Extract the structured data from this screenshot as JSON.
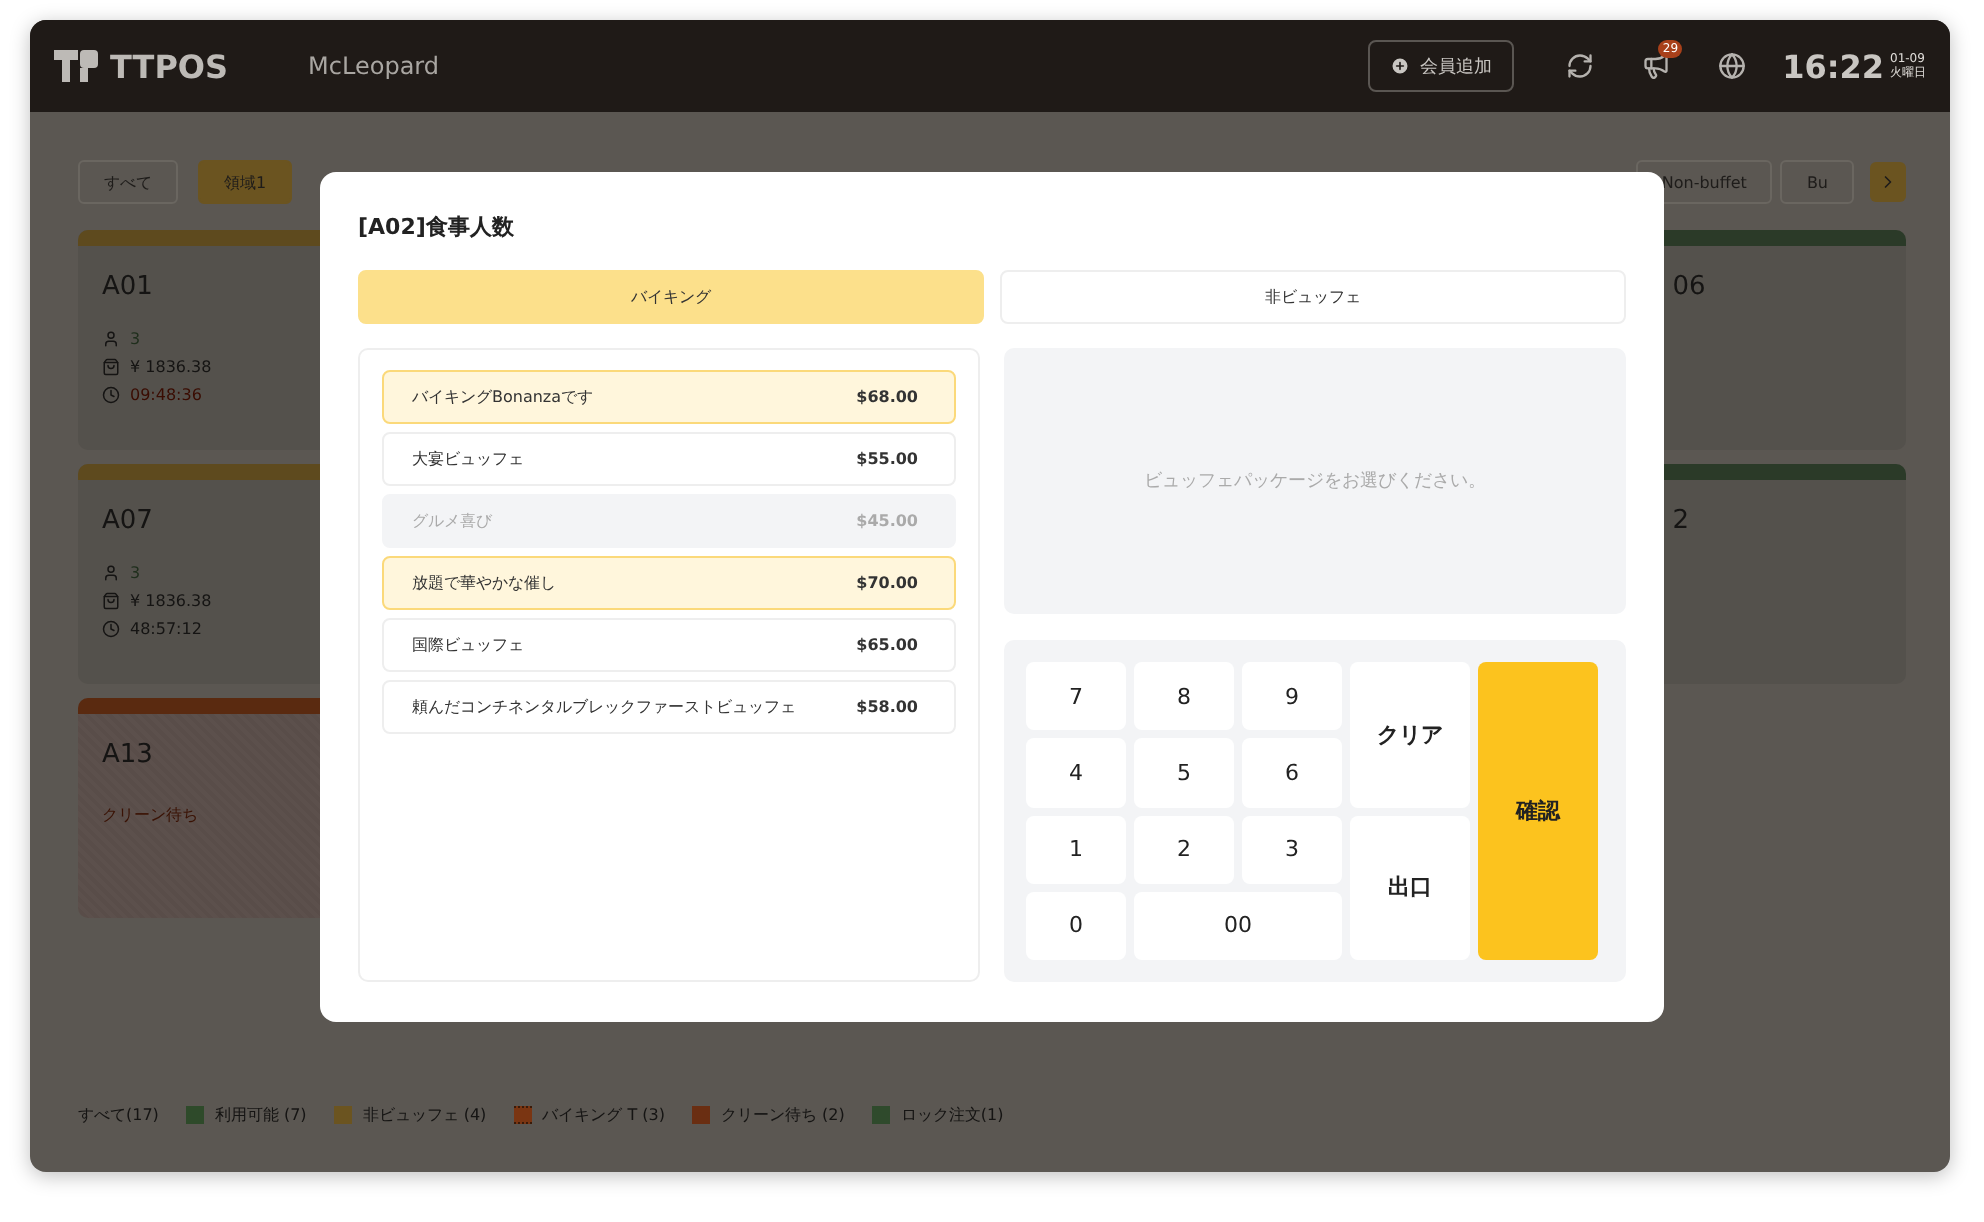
{
  "header": {
    "brand": "TTPOS",
    "store": "McLeopard",
    "add_member": "会員追加",
    "notification_count": "29",
    "time": "16:22",
    "date": "01-09",
    "weekday": "火曜日"
  },
  "filters": {
    "left": [
      {
        "label": "すべて",
        "selected": false
      },
      {
        "label": "領域1",
        "selected": true
      }
    ],
    "right": [
      {
        "label": "Non-buffet",
        "selected": false
      },
      {
        "label": "Bu",
        "selected": false
      }
    ]
  },
  "left_cards": [
    {
      "title": "A01",
      "color": "#5e4a1e",
      "kind": "occupied",
      "guests": "3",
      "amount": "¥ 1836.38",
      "timer": "09:48:36",
      "timer_alert": true
    },
    {
      "title": "A07",
      "color": "#5e4a1e",
      "kind": "occupied",
      "guests": "3",
      "amount": "¥ 1836.38",
      "timer": "48:57:12",
      "timer_alert": false
    },
    {
      "title": "A13",
      "color": "#5a2a10",
      "kind": "cleaning",
      "status": "クリーン待ち"
    }
  ],
  "right_cards": [
    {
      "title": "06",
      "color": "#2b3a28"
    },
    {
      "title": "2",
      "color": "#2b3a28"
    }
  ],
  "legend": [
    {
      "label": "すべて(17)"
    },
    {
      "label": "利用可能 (7)",
      "color": "#2e4a2a"
    },
    {
      "label": "非ビュッフェ (4)",
      "color": "#6b5420"
    },
    {
      "label": "バイキング T (3)",
      "color": "#7a3512",
      "kind": "hatched"
    },
    {
      "label": "クリーン待ち (2)",
      "color": "#6a2e12"
    },
    {
      "label": "ロック注文(1)",
      "color": "#2f4a2c"
    }
  ],
  "dialog": {
    "title": "[A02]食事人数",
    "tabs": [
      {
        "label": "バイキング",
        "selected": true
      },
      {
        "label": "非ビュッフェ",
        "selected": false
      }
    ],
    "packages": [
      {
        "name": "バイキングBonanzaです",
        "price": "$68.00",
        "selected": true,
        "disabled": false
      },
      {
        "name": "大宴ビュッフェ",
        "price": "$55.00",
        "selected": false,
        "disabled": false
      },
      {
        "name": "グルメ喜び",
        "price": "$45.00",
        "selected": false,
        "disabled": true
      },
      {
        "name": "放題で華やかな催し",
        "price": "$70.00",
        "selected": true,
        "disabled": false
      },
      {
        "name": "国際ビュッフェ",
        "price": "$65.00",
        "selected": false,
        "disabled": false
      },
      {
        "name": "頼んだコンチネンタルブレックファーストビュッフェ",
        "price": "$58.00",
        "selected": false,
        "disabled": false
      }
    ],
    "message": "ビュッフェパッケージをお選びください。",
    "keys": [
      {
        "label": "7",
        "kind": "digit"
      },
      {
        "label": "8",
        "kind": "digit"
      },
      {
        "label": "9",
        "kind": "digit"
      },
      {
        "label": "クリア",
        "kind": "clear"
      },
      {
        "label": "確認",
        "kind": "confirm"
      },
      {
        "label": "4",
        "kind": "digit"
      },
      {
        "label": "5",
        "kind": "digit"
      },
      {
        "label": "6",
        "kind": "digit"
      },
      {
        "label": "1",
        "kind": "digit"
      },
      {
        "label": "2",
        "kind": "digit"
      },
      {
        "label": "3",
        "kind": "digit"
      },
      {
        "label": "出口",
        "kind": "exit"
      },
      {
        "label": "0",
        "kind": "digit"
      },
      {
        "label": "00",
        "kind": "wide"
      }
    ]
  }
}
